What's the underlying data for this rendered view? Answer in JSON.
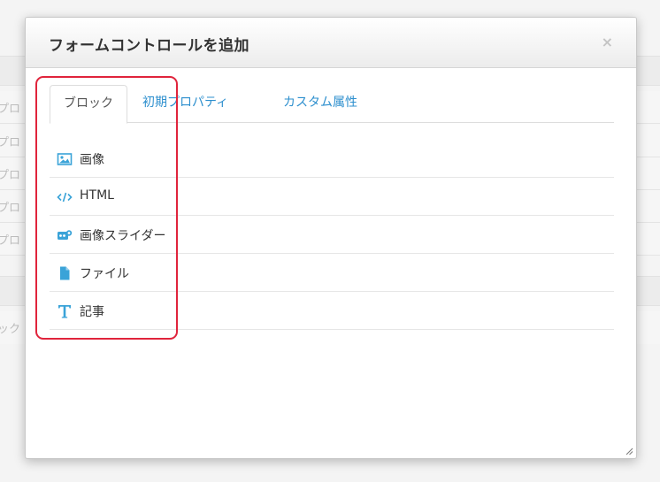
{
  "background": {
    "row_labels": [
      "プロ",
      "プロ",
      "プロ",
      "プロ",
      "プロ",
      "ック（"
    ]
  },
  "modal": {
    "title": "フォームコントロールを追加",
    "close_label": "×",
    "tabs": [
      {
        "label": "ブロック",
        "active": true
      },
      {
        "label": "初期プロパティ",
        "active": false
      },
      {
        "label": "カスタム属性",
        "active": false
      }
    ],
    "items": [
      {
        "label": "画像",
        "icon": "image-icon"
      },
      {
        "label": "HTML",
        "icon": "code-icon"
      },
      {
        "label": "画像スライダー",
        "icon": "slider-icon"
      },
      {
        "label": "ファイル",
        "icon": "file-icon"
      },
      {
        "label": "記事",
        "icon": "text-icon"
      }
    ]
  },
  "colors": {
    "accent": "#2d8fce",
    "icon": "#3aa3d8",
    "highlight": "#e0243c"
  }
}
